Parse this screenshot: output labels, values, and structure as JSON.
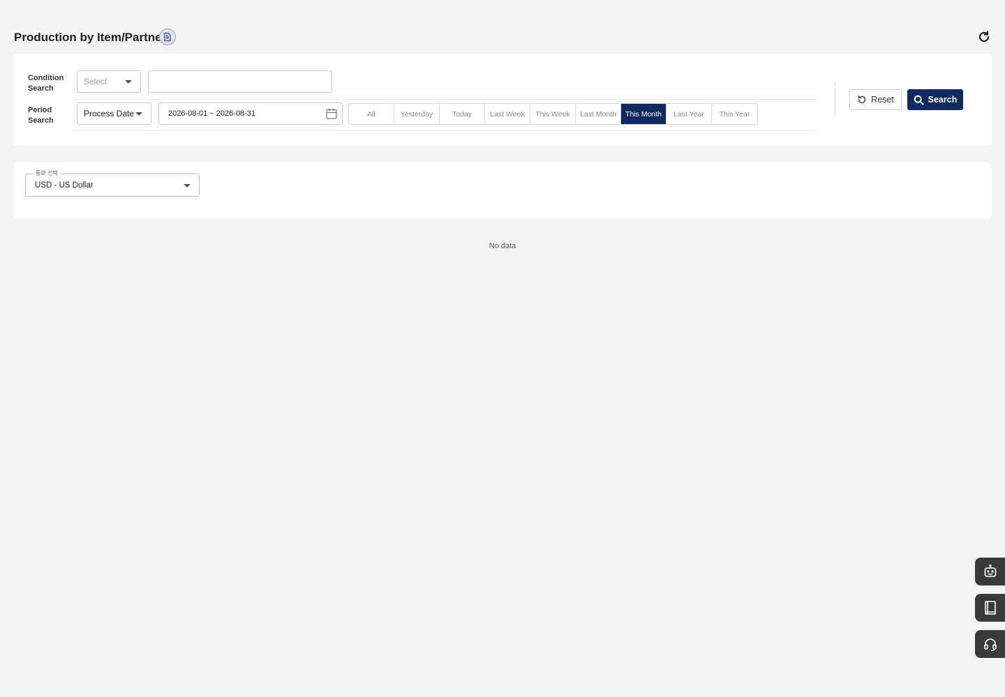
{
  "header": {
    "title": "Production by Item/Partner"
  },
  "filters": {
    "condition_label": "Condition Search",
    "condition_select_placeholder": "Select",
    "condition_text_value": "",
    "period_label": "Period Search",
    "period_type": "Process Date",
    "date_range": "2026-08-01 ~ 2026-08-31",
    "period_options": [
      "All",
      "Yesterday",
      "Today",
      "Last Week",
      "This Week",
      "Last Month",
      "This Month",
      "Last Year",
      "This Year"
    ],
    "period_active": "This Month",
    "reset_label": "Reset",
    "search_label": "Search"
  },
  "currency": {
    "label": "통화 선택",
    "value": "USD - US Dollar"
  },
  "results": {
    "empty_text": "No data"
  },
  "colors": {
    "primary": "#0f2a5e",
    "background": "#f4f4f4",
    "fab": "#3a3a3a"
  }
}
